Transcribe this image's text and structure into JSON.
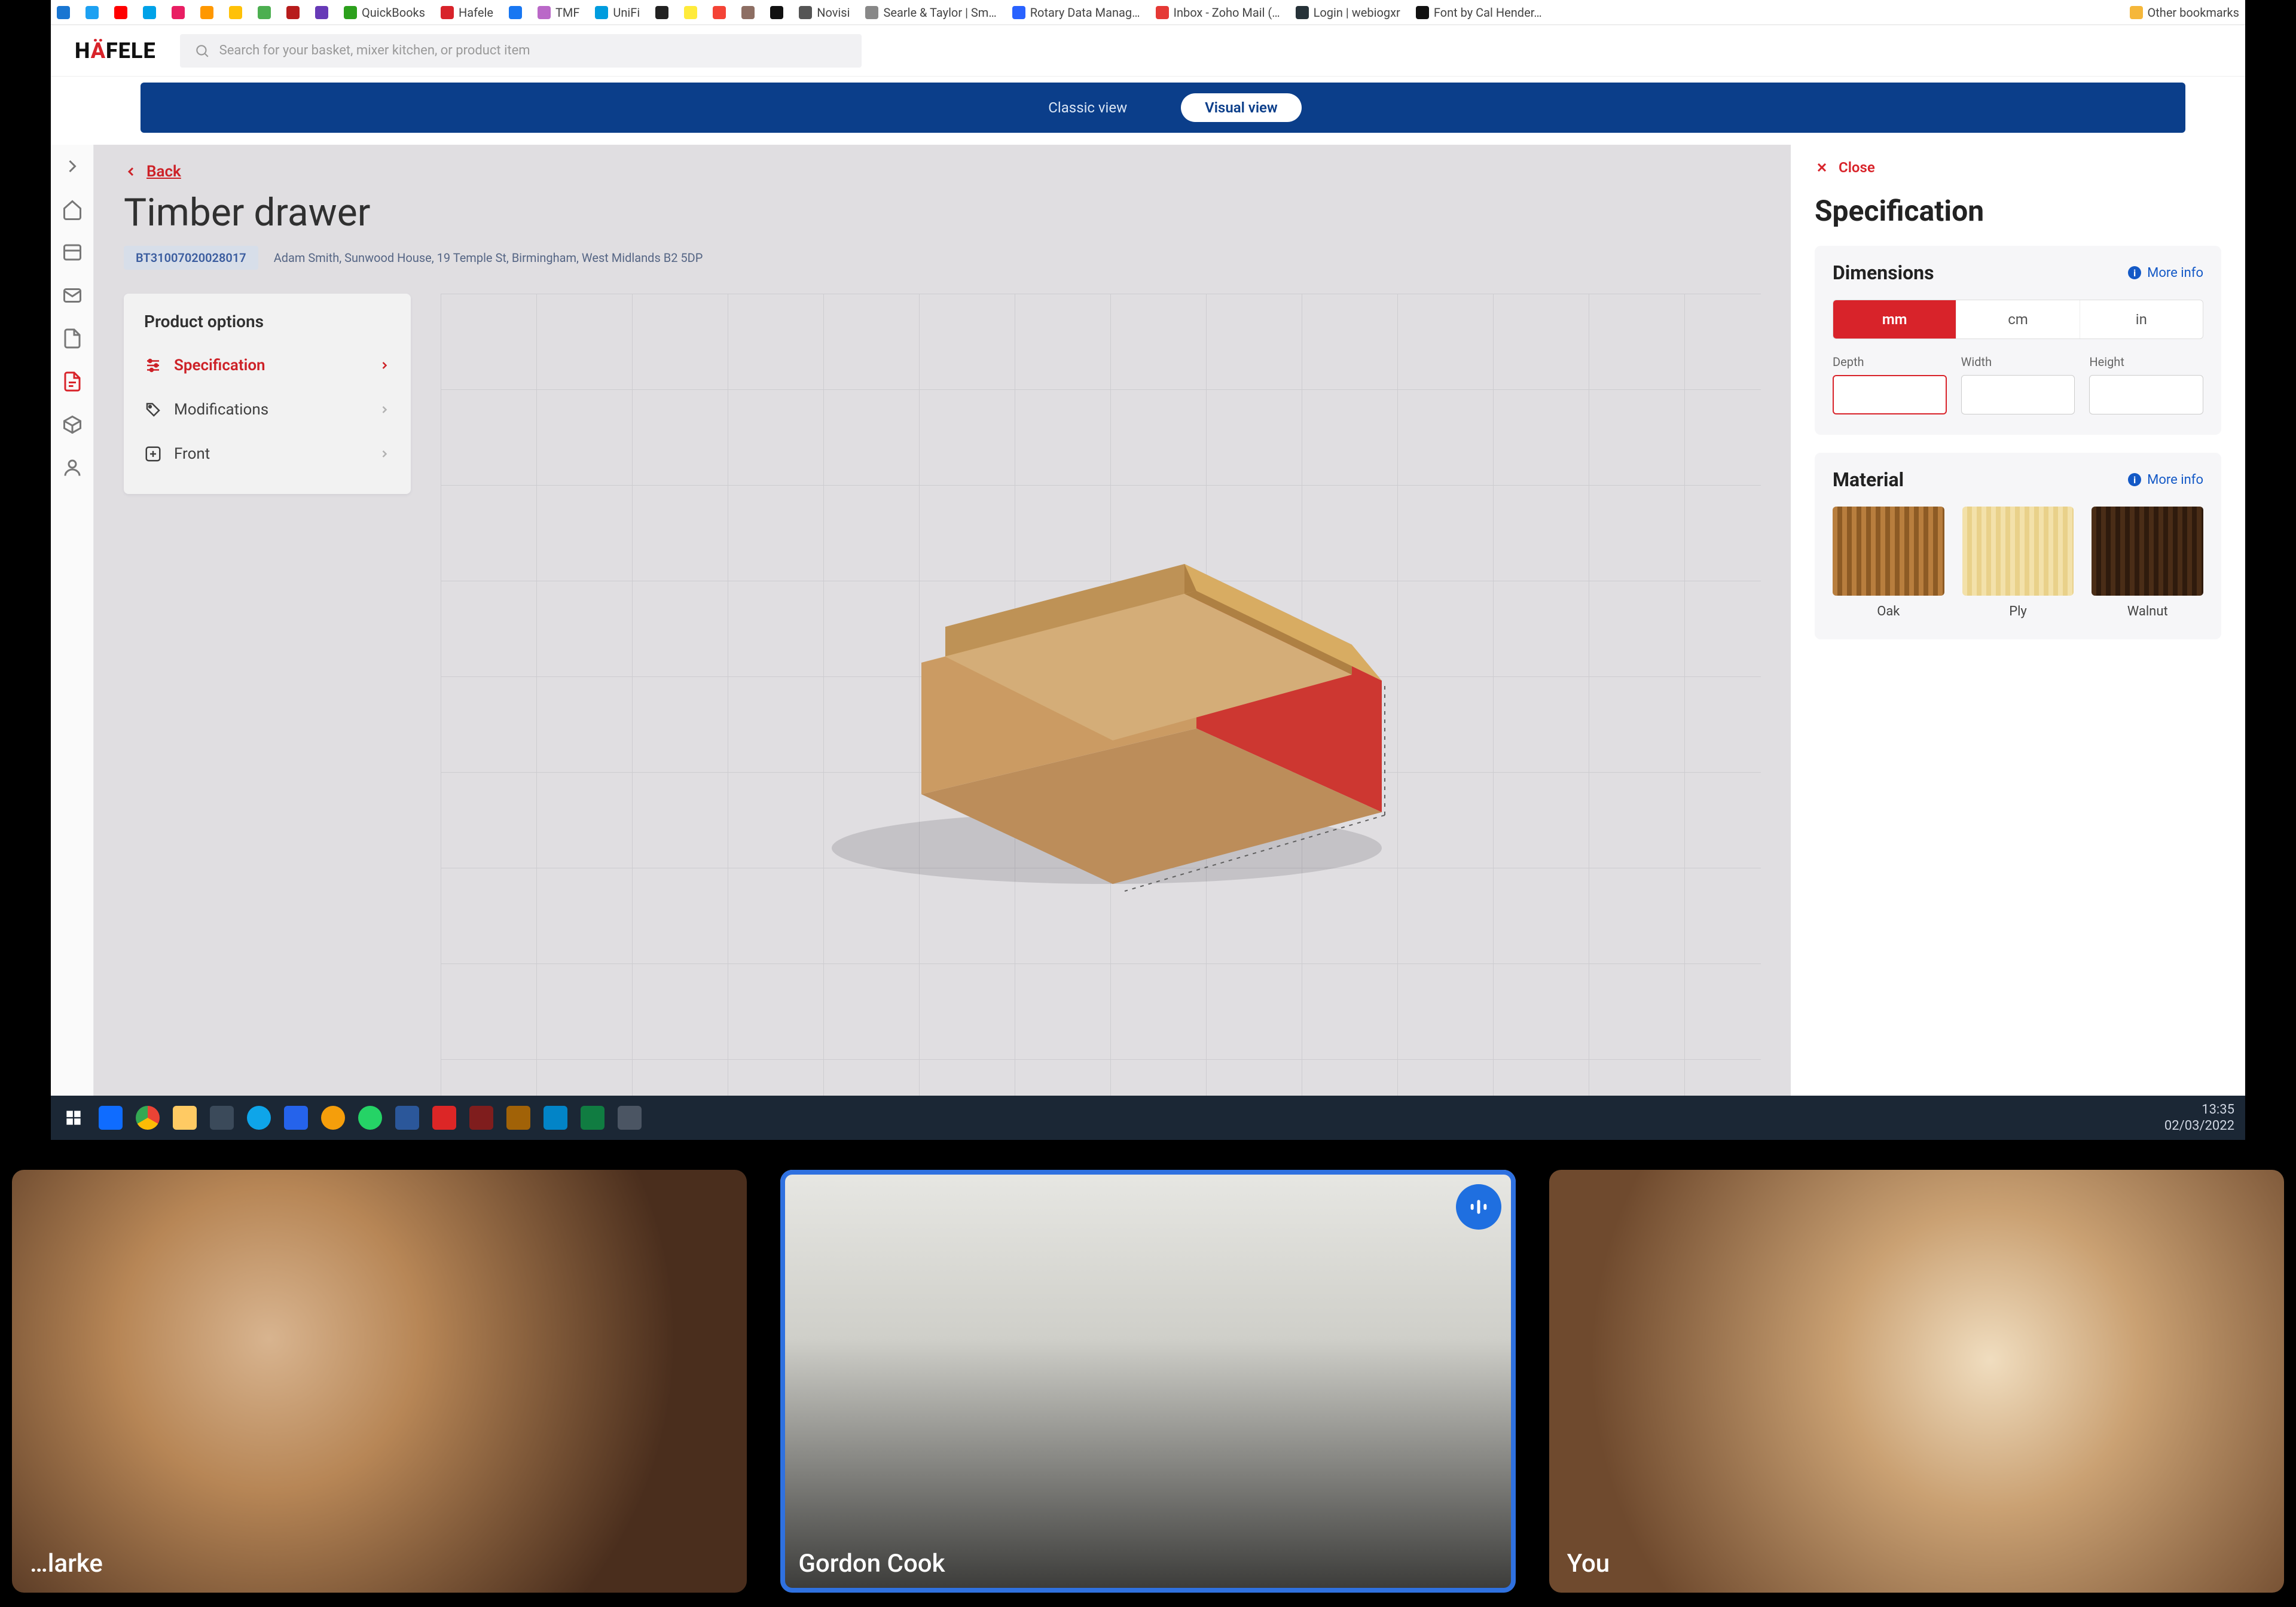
{
  "bookmarks": {
    "items": [
      {
        "label": "",
        "color": "#1976d2"
      },
      {
        "label": "",
        "color": "#1da1f2"
      },
      {
        "label": "",
        "color": "#ff0000"
      },
      {
        "label": "",
        "color": "#00a2e8"
      },
      {
        "label": "",
        "color": "#e91e63"
      },
      {
        "label": "",
        "color": "#ff9800"
      },
      {
        "label": "",
        "color": "#ffc107"
      },
      {
        "label": "",
        "color": "#4caf50"
      },
      {
        "label": "",
        "color": "#b71c1c"
      },
      {
        "label": "",
        "color": "#673ab7"
      },
      {
        "label": "QuickBooks",
        "color": "#2ca01c"
      },
      {
        "label": "Hafele",
        "color": "#d8232a"
      },
      {
        "label": "",
        "color": "#1877f2"
      },
      {
        "label": "TMF",
        "color": "#ba68c8"
      },
      {
        "label": "UniFi",
        "color": "#009cde"
      },
      {
        "label": "",
        "color": "#212121"
      },
      {
        "label": "",
        "color": "#ffeb3b"
      },
      {
        "label": "",
        "color": "#f44336"
      },
      {
        "label": "",
        "color": "#8d6e63"
      },
      {
        "label": "",
        "color": "#111111"
      },
      {
        "label": "Novisi",
        "color": "#555555"
      },
      {
        "label": "Searle & Taylor | Sm…",
        "color": "#888888"
      },
      {
        "label": "Rotary Data Manag…",
        "color": "#2962ff"
      },
      {
        "label": "Inbox - Zoho Mail (…",
        "color": "#e53935"
      },
      {
        "label": "Login | webiogxr",
        "color": "#263238"
      },
      {
        "label": "Font by Cal Hender…",
        "color": "#111111"
      }
    ],
    "other": "Other bookmarks"
  },
  "header": {
    "brand_prefix": "H",
    "brand_accent": "Ä",
    "brand_suffix": "FELE",
    "search_placeholder": "Search for your basket, mixer kitchen, or product item"
  },
  "viewbar": {
    "classic": "Classic view",
    "visual": "Visual view"
  },
  "leftRail": {
    "items": [
      "chevron-right",
      "home",
      "orders",
      "mail",
      "document",
      "pdf",
      "package",
      "user"
    ]
  },
  "page": {
    "back": "Back",
    "title": "Timber drawer",
    "order_ref": "BT31007020028017",
    "address": "Adam Smith, Sunwood House, 19 Temple St, Birmingham, West Midlands B2 5DP"
  },
  "options": {
    "heading": "Product options",
    "items": [
      {
        "icon": "sliders",
        "label": "Specification",
        "active": true
      },
      {
        "icon": "tag",
        "label": "Modifications",
        "active": false
      },
      {
        "icon": "plus-sq",
        "label": "Front",
        "active": false
      }
    ]
  },
  "spec": {
    "close": "Close",
    "title": "Specification",
    "dimensions": {
      "heading": "Dimensions",
      "more": "More info",
      "units": [
        "mm",
        "cm",
        "in"
      ],
      "unit_active": 0,
      "fields": {
        "depth": {
          "label": "Depth",
          "value": ""
        },
        "width": {
          "label": "Width",
          "value": ""
        },
        "height": {
          "label": "Height",
          "value": ""
        }
      }
    },
    "material": {
      "heading": "Material",
      "more": "More info",
      "items": [
        {
          "label": "Oak",
          "color1": "#b87e3e",
          "color2": "#8d5b25"
        },
        {
          "label": "Ply",
          "color1": "#f3e1aa",
          "color2": "#e9d18a"
        },
        {
          "label": "Walnut",
          "color1": "#4a2d17",
          "color2": "#2f1b0d"
        }
      ]
    }
  },
  "taskbar": {
    "clock_time": "13:35",
    "clock_date": "02/03/2022"
  },
  "tiles": {
    "p1": "…larke",
    "p2": "Gordon Cook",
    "p3": "You"
  }
}
